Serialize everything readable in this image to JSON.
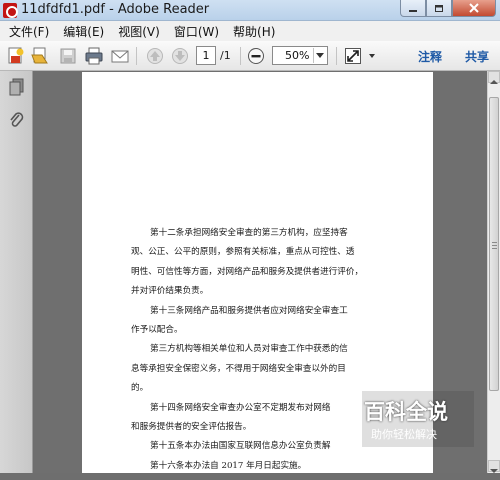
{
  "window": {
    "title": "11dfdfd1.pdf - Adobe Reader",
    "controls": [
      "minimize",
      "restore",
      "close"
    ]
  },
  "menu": [
    "文件(F)",
    "编辑(E)",
    "视图(V)",
    "窗口(W)",
    "帮助(H)"
  ],
  "toolbar": {
    "icons": [
      "create-pdf-icon",
      "open-icon",
      "save-icon",
      "print-icon",
      "email-icon",
      "previous-page-icon",
      "next-page-icon",
      "zoom-out-icon",
      "fit-page-icon",
      "zoom-dropdown-icon"
    ],
    "page_current": "1",
    "page_total": "/1",
    "zoom": "50%",
    "comment_label": "注释",
    "share_label": "共享"
  },
  "navpanel": {
    "icons": [
      "pages-icon",
      "attachments-icon"
    ]
  },
  "document": {
    "lines": [
      {
        "text": "第十二条承担网络安全审查的第三方机构，应坚持客",
        "indent": true
      },
      {
        "text": "观、公正、公平的原则，参照有关标准，重点从可控性、透",
        "indent": false
      },
      {
        "text": "明性、可信性等方面，对网络产品和服务及提供者进行评价，",
        "indent": false
      },
      {
        "text": "并对评价结果负责。",
        "indent": false
      },
      {
        "text": "第十三条网络产品和服务提供者应对网络安全审查工",
        "indent": true
      },
      {
        "text": "作予以配合。",
        "indent": false
      },
      {
        "text": "第三方机构等相关单位和人员对审查工作中获悉的信",
        "indent": true
      },
      {
        "text": "息等承担安全保密义务，不得用于网络安全审查以外的目",
        "indent": false
      },
      {
        "text": "的。",
        "indent": false
      },
      {
        "text": "第十四条网络安全审查办公室不定期发布对网络",
        "indent": true
      },
      {
        "text": "和服务提供者的安全评估报告。",
        "indent": false
      },
      {
        "text": "第十五条本办法由国家互联网信息办公室负责解",
        "indent": true
      },
      {
        "text": "第十六条本办法自 2017 年月日起实施。",
        "indent": true
      }
    ]
  },
  "watermark": {
    "title": "百科全说",
    "subtitle": "助你轻松解决"
  },
  "colors": {
    "accent_link": "#1f5aa6",
    "doc_background": "#6f6f6f",
    "close_button": "#c24a31"
  }
}
